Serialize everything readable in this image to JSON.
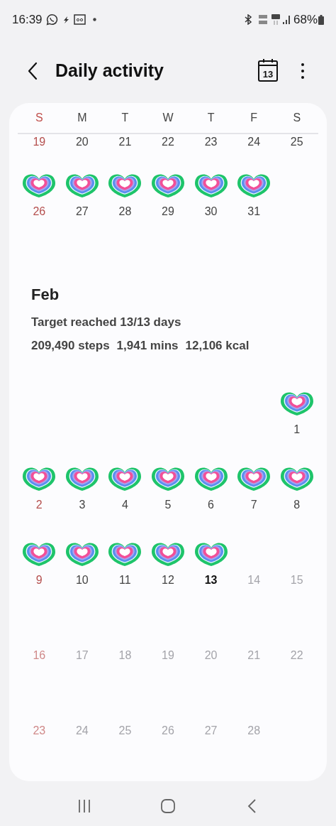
{
  "status_bar": {
    "time": "16:39",
    "battery": "68%"
  },
  "header": {
    "title": "Daily activity",
    "calendar_day": "13"
  },
  "weekdays": [
    "S",
    "M",
    "T",
    "W",
    "T",
    "F",
    "S"
  ],
  "sections": [
    {
      "weeks": [
        {
          "kind": "partial",
          "days": [
            {
              "day": "19",
              "kind": "past"
            },
            {
              "day": "20",
              "kind": "past"
            },
            {
              "day": "21",
              "kind": "past"
            },
            {
              "day": "22",
              "kind": "past"
            },
            {
              "day": "23",
              "kind": "past"
            },
            {
              "day": "24",
              "kind": "past"
            },
            {
              "day": "25",
              "kind": "past"
            }
          ]
        },
        {
          "kind": "full",
          "days": [
            {
              "day": "26",
              "kind": "past",
              "goal_reached": true
            },
            {
              "day": "27",
              "kind": "past",
              "goal_reached": true
            },
            {
              "day": "28",
              "kind": "past",
              "goal_reached": true
            },
            {
              "day": "29",
              "kind": "past",
              "goal_reached": true
            },
            {
              "day": "30",
              "kind": "past",
              "goal_reached": true
            },
            {
              "day": "31",
              "kind": "past",
              "goal_reached": true
            }
          ]
        }
      ]
    },
    {
      "month": "Feb",
      "target": "Target reached 13/13 days",
      "stats": [
        "209,490 steps",
        "1,941 mins",
        "12,106 kcal"
      ],
      "weeks": [
        {
          "kind": "full",
          "days": [
            {
              "kind": "empty"
            },
            {
              "kind": "empty"
            },
            {
              "kind": "empty"
            },
            {
              "kind": "empty"
            },
            {
              "kind": "empty"
            },
            {
              "kind": "empty"
            },
            {
              "day": "1",
              "kind": "past",
              "goal_reached": true
            }
          ]
        },
        {
          "kind": "full",
          "days": [
            {
              "day": "2",
              "kind": "past",
              "goal_reached": true
            },
            {
              "day": "3",
              "kind": "past",
              "goal_reached": true
            },
            {
              "day": "4",
              "kind": "past",
              "goal_reached": true
            },
            {
              "day": "5",
              "kind": "past",
              "goal_reached": true
            },
            {
              "day": "6",
              "kind": "past",
              "goal_reached": true
            },
            {
              "day": "7",
              "kind": "past",
              "goal_reached": true
            },
            {
              "day": "8",
              "kind": "past",
              "goal_reached": true
            }
          ]
        },
        {
          "kind": "full",
          "days": [
            {
              "day": "9",
              "kind": "past",
              "goal_reached": true
            },
            {
              "day": "10",
              "kind": "past",
              "goal_reached": true
            },
            {
              "day": "11",
              "kind": "past",
              "goal_reached": true
            },
            {
              "day": "12",
              "kind": "past",
              "goal_reached": true
            },
            {
              "day": "13",
              "kind": "today",
              "goal_reached": true
            },
            {
              "day": "14",
              "kind": "future",
              "goal_reached": false
            },
            {
              "day": "15",
              "kind": "future",
              "goal_reached": false
            }
          ]
        },
        {
          "kind": "full",
          "days": [
            {
              "day": "16",
              "kind": "future",
              "goal_reached": false
            },
            {
              "day": "17",
              "kind": "future",
              "goal_reached": false
            },
            {
              "day": "18",
              "kind": "future",
              "goal_reached": false
            },
            {
              "day": "19",
              "kind": "future",
              "goal_reached": false
            },
            {
              "day": "20",
              "kind": "future",
              "goal_reached": false
            },
            {
              "day": "21",
              "kind": "future",
              "goal_reached": false
            },
            {
              "day": "22",
              "kind": "future",
              "goal_reached": false
            }
          ]
        },
        {
          "kind": "full",
          "days": [
            {
              "day": "23",
              "kind": "future",
              "goal_reached": false
            },
            {
              "day": "24",
              "kind": "future",
              "goal_reached": false
            },
            {
              "day": "25",
              "kind": "future",
              "goal_reached": false
            },
            {
              "day": "26",
              "kind": "future",
              "goal_reached": false
            },
            {
              "day": "27",
              "kind": "future",
              "goal_reached": false
            },
            {
              "day": "28",
              "kind": "future",
              "goal_reached": false
            }
          ]
        }
      ]
    }
  ]
}
